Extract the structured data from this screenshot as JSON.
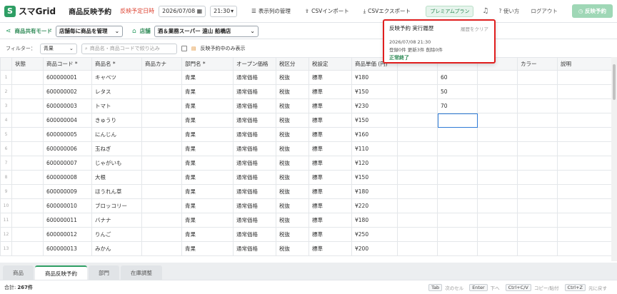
{
  "app": {
    "logo_mark": "S",
    "name": "スマGrid"
  },
  "header": {
    "page_title": "商品反映予約",
    "schedule_label": "反映予定日時",
    "date_value": "2026/07/08",
    "time_value": "21:30",
    "buttons": {
      "display_columns": "表示列の管理",
      "csv_import": "CSVインポート",
      "csv_export": "CSVエクスポート"
    },
    "premium": "プレミアムプラン",
    "help": "使い方",
    "logout": "ログアウト",
    "apply": "反映予約"
  },
  "subbar": {
    "mode_label": "商品共有モード",
    "mode_value": "店舗毎に商品を管理",
    "store_label": "店舗",
    "store_value": "酒＆業務スーパー 遠山 船橋店"
  },
  "filters": {
    "label": "フィルター：",
    "category": "青果",
    "search_placeholder": "商品名・商品コードで絞り込み",
    "reserved_only": "反映予約中のみ表示"
  },
  "popup": {
    "title": "反映予約 実行履歴",
    "clear": "履歴をクリア",
    "datetime": "2026/07/08 21:30",
    "summary": "登録0件 更新3件 削除0件",
    "status": "正常終了"
  },
  "table": {
    "headers": [
      "",
      "状態",
      "商品コード *",
      "商品名 *",
      "商品カナ",
      "部門名 *",
      "オープン価格",
      "税区分",
      "税設定",
      "商品単価 (円)",
      "",
      "",
      "",
      "カラー",
      "説明"
    ],
    "rows": [
      [
        "1",
        "",
        "600000001",
        "キャベツ",
        "",
        "青果",
        "通常価格",
        "税抜",
        "標準",
        "¥180",
        "",
        "60",
        "",
        "",
        ""
      ],
      [
        "2",
        "",
        "600000002",
        "レタス",
        "",
        "青果",
        "通常価格",
        "税抜",
        "標準",
        "¥150",
        "",
        "50",
        "",
        "",
        ""
      ],
      [
        "3",
        "",
        "600000003",
        "トマト",
        "",
        "青果",
        "通常価格",
        "税抜",
        "標準",
        "¥230",
        "",
        "70",
        "",
        "",
        ""
      ],
      [
        "4",
        "",
        "600000004",
        "きゅうり",
        "",
        "青果",
        "通常価格",
        "税抜",
        "標準",
        "¥150",
        "",
        "",
        "",
        "",
        ""
      ],
      [
        "5",
        "",
        "600000005",
        "にんじん",
        "",
        "青果",
        "通常価格",
        "税抜",
        "標準",
        "¥160",
        "",
        "",
        "",
        "",
        ""
      ],
      [
        "6",
        "",
        "600000006",
        "玉ねぎ",
        "",
        "青果",
        "通常価格",
        "税抜",
        "標準",
        "¥110",
        "",
        "",
        "",
        "",
        ""
      ],
      [
        "7",
        "",
        "600000007",
        "じゃがいも",
        "",
        "青果",
        "通常価格",
        "税抜",
        "標準",
        "¥120",
        "",
        "",
        "",
        "",
        ""
      ],
      [
        "8",
        "",
        "600000008",
        "大根",
        "",
        "青果",
        "通常価格",
        "税抜",
        "標準",
        "¥150",
        "",
        "",
        "",
        "",
        ""
      ],
      [
        "9",
        "",
        "600000009",
        "ほうれん草",
        "",
        "青果",
        "通常価格",
        "税抜",
        "標準",
        "¥180",
        "",
        "",
        "",
        "",
        ""
      ],
      [
        "10",
        "",
        "600000010",
        "ブロッコリー",
        "",
        "青果",
        "通常価格",
        "税抜",
        "標準",
        "¥220",
        "",
        "",
        "",
        "",
        ""
      ],
      [
        "11",
        "",
        "600000011",
        "バナナ",
        "",
        "青果",
        "通常価格",
        "税抜",
        "標準",
        "¥180",
        "",
        "",
        "",
        "",
        ""
      ],
      [
        "12",
        "",
        "600000012",
        "りんご",
        "",
        "青果",
        "通常価格",
        "税抜",
        "標準",
        "¥250",
        "",
        "",
        "",
        "",
        ""
      ],
      [
        "13",
        "",
        "600000013",
        "みかん",
        "",
        "青果",
        "通常価格",
        "税抜",
        "標準",
        "¥200",
        "",
        "",
        "",
        "",
        ""
      ]
    ]
  },
  "tabs": [
    "商品",
    "商品反映予約",
    "部門",
    "在庫調整"
  ],
  "active_tab": 1,
  "status": {
    "total_label": "合計:",
    "total_value": "267件",
    "hints": [
      {
        "key": "Tab",
        "desc": "次のセル"
      },
      {
        "key": "Enter",
        "desc": "下へ"
      },
      {
        "key": "Ctrl+C/V",
        "desc": "コピー/貼付"
      },
      {
        "key": "Ctrl+Z",
        "desc": "元に戻す"
      }
    ]
  },
  "colors": {
    "brand": "#2e9e64",
    "alert": "#e01e1e",
    "selection": "#2f7bd6"
  }
}
